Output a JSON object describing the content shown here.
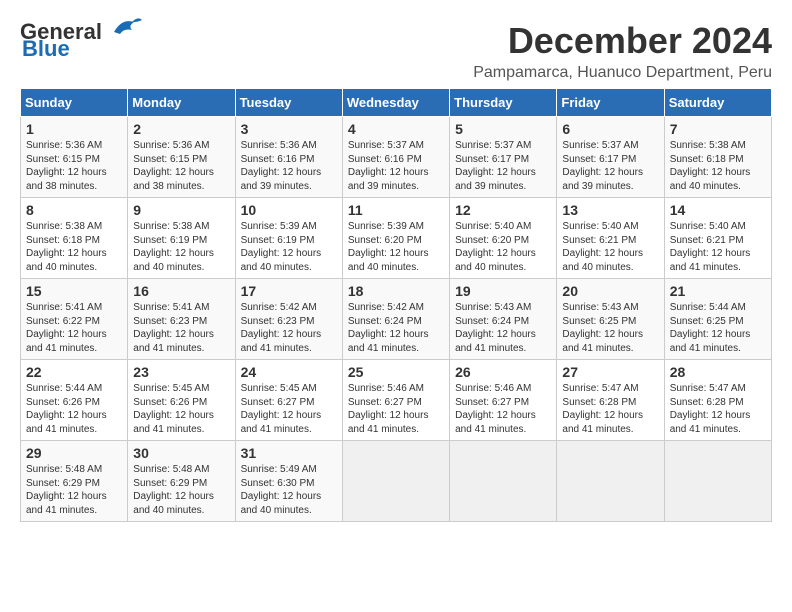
{
  "header": {
    "logo_line1": "General",
    "logo_line2": "Blue",
    "title": "December 2024",
    "subtitle": "Pampamarca, Huanuco Department, Peru"
  },
  "columns": [
    "Sunday",
    "Monday",
    "Tuesday",
    "Wednesday",
    "Thursday",
    "Friday",
    "Saturday"
  ],
  "weeks": [
    [
      {
        "day": "1",
        "info": "Sunrise: 5:36 AM\nSunset: 6:15 PM\nDaylight: 12 hours\nand 38 minutes."
      },
      {
        "day": "2",
        "info": "Sunrise: 5:36 AM\nSunset: 6:15 PM\nDaylight: 12 hours\nand 38 minutes."
      },
      {
        "day": "3",
        "info": "Sunrise: 5:36 AM\nSunset: 6:16 PM\nDaylight: 12 hours\nand 39 minutes."
      },
      {
        "day": "4",
        "info": "Sunrise: 5:37 AM\nSunset: 6:16 PM\nDaylight: 12 hours\nand 39 minutes."
      },
      {
        "day": "5",
        "info": "Sunrise: 5:37 AM\nSunset: 6:17 PM\nDaylight: 12 hours\nand 39 minutes."
      },
      {
        "day": "6",
        "info": "Sunrise: 5:37 AM\nSunset: 6:17 PM\nDaylight: 12 hours\nand 39 minutes."
      },
      {
        "day": "7",
        "info": "Sunrise: 5:38 AM\nSunset: 6:18 PM\nDaylight: 12 hours\nand 40 minutes."
      }
    ],
    [
      {
        "day": "8",
        "info": "Sunrise: 5:38 AM\nSunset: 6:18 PM\nDaylight: 12 hours\nand 40 minutes."
      },
      {
        "day": "9",
        "info": "Sunrise: 5:38 AM\nSunset: 6:19 PM\nDaylight: 12 hours\nand 40 minutes."
      },
      {
        "day": "10",
        "info": "Sunrise: 5:39 AM\nSunset: 6:19 PM\nDaylight: 12 hours\nand 40 minutes."
      },
      {
        "day": "11",
        "info": "Sunrise: 5:39 AM\nSunset: 6:20 PM\nDaylight: 12 hours\nand 40 minutes."
      },
      {
        "day": "12",
        "info": "Sunrise: 5:40 AM\nSunset: 6:20 PM\nDaylight: 12 hours\nand 40 minutes."
      },
      {
        "day": "13",
        "info": "Sunrise: 5:40 AM\nSunset: 6:21 PM\nDaylight: 12 hours\nand 40 minutes."
      },
      {
        "day": "14",
        "info": "Sunrise: 5:40 AM\nSunset: 6:21 PM\nDaylight: 12 hours\nand 41 minutes."
      }
    ],
    [
      {
        "day": "15",
        "info": "Sunrise: 5:41 AM\nSunset: 6:22 PM\nDaylight: 12 hours\nand 41 minutes."
      },
      {
        "day": "16",
        "info": "Sunrise: 5:41 AM\nSunset: 6:23 PM\nDaylight: 12 hours\nand 41 minutes."
      },
      {
        "day": "17",
        "info": "Sunrise: 5:42 AM\nSunset: 6:23 PM\nDaylight: 12 hours\nand 41 minutes."
      },
      {
        "day": "18",
        "info": "Sunrise: 5:42 AM\nSunset: 6:24 PM\nDaylight: 12 hours\nand 41 minutes."
      },
      {
        "day": "19",
        "info": "Sunrise: 5:43 AM\nSunset: 6:24 PM\nDaylight: 12 hours\nand 41 minutes."
      },
      {
        "day": "20",
        "info": "Sunrise: 5:43 AM\nSunset: 6:25 PM\nDaylight: 12 hours\nand 41 minutes."
      },
      {
        "day": "21",
        "info": "Sunrise: 5:44 AM\nSunset: 6:25 PM\nDaylight: 12 hours\nand 41 minutes."
      }
    ],
    [
      {
        "day": "22",
        "info": "Sunrise: 5:44 AM\nSunset: 6:26 PM\nDaylight: 12 hours\nand 41 minutes."
      },
      {
        "day": "23",
        "info": "Sunrise: 5:45 AM\nSunset: 6:26 PM\nDaylight: 12 hours\nand 41 minutes."
      },
      {
        "day": "24",
        "info": "Sunrise: 5:45 AM\nSunset: 6:27 PM\nDaylight: 12 hours\nand 41 minutes."
      },
      {
        "day": "25",
        "info": "Sunrise: 5:46 AM\nSunset: 6:27 PM\nDaylight: 12 hours\nand 41 minutes."
      },
      {
        "day": "26",
        "info": "Sunrise: 5:46 AM\nSunset: 6:27 PM\nDaylight: 12 hours\nand 41 minutes."
      },
      {
        "day": "27",
        "info": "Sunrise: 5:47 AM\nSunset: 6:28 PM\nDaylight: 12 hours\nand 41 minutes."
      },
      {
        "day": "28",
        "info": "Sunrise: 5:47 AM\nSunset: 6:28 PM\nDaylight: 12 hours\nand 41 minutes."
      }
    ],
    [
      {
        "day": "29",
        "info": "Sunrise: 5:48 AM\nSunset: 6:29 PM\nDaylight: 12 hours\nand 41 minutes."
      },
      {
        "day": "30",
        "info": "Sunrise: 5:48 AM\nSunset: 6:29 PM\nDaylight: 12 hours\nand 40 minutes."
      },
      {
        "day": "31",
        "info": "Sunrise: 5:49 AM\nSunset: 6:30 PM\nDaylight: 12 hours\nand 40 minutes."
      },
      {
        "day": "",
        "info": ""
      },
      {
        "day": "",
        "info": ""
      },
      {
        "day": "",
        "info": ""
      },
      {
        "day": "",
        "info": ""
      }
    ]
  ]
}
